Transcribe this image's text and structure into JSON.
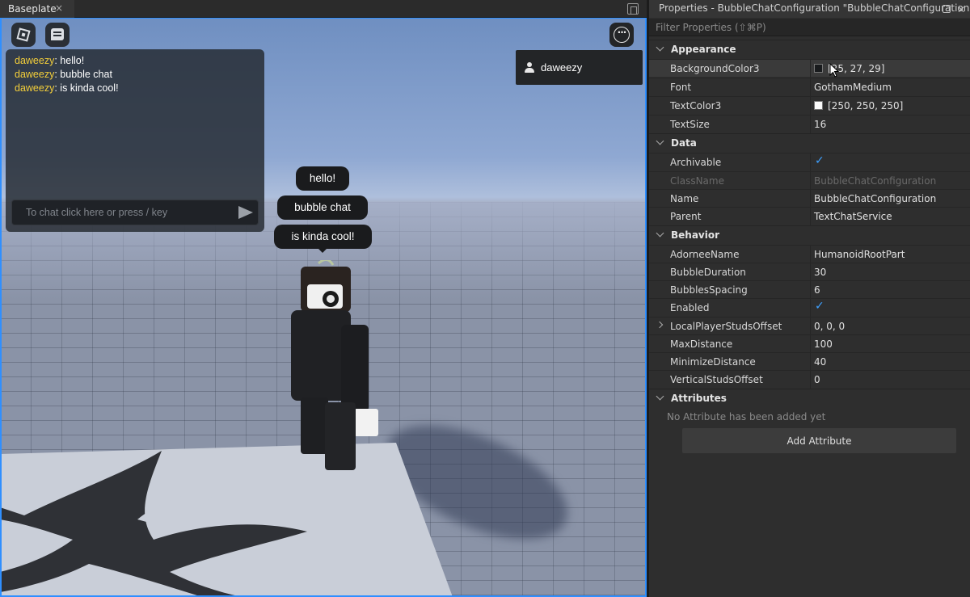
{
  "viewport": {
    "tab_label": "Baseplate",
    "tab_close": "×",
    "chat": {
      "messages": [
        {
          "user": "daweezy",
          "text": ": hello!"
        },
        {
          "user": "daweezy",
          "text": ": bubble chat"
        },
        {
          "user": "daweezy",
          "text": ": is kinda cool!"
        }
      ],
      "input_placeholder": "To chat click here or press / key"
    },
    "player_list": {
      "player": "daweezy"
    },
    "bubbles": [
      "hello!",
      "bubble chat",
      "is kinda cool!"
    ],
    "menu_glyph": "···"
  },
  "properties": {
    "title": "Properties - BubbleChatConfiguration \"BubbleChatConfiguration\"",
    "close_glyph": "✕",
    "filter_placeholder": "Filter Properties (⇧⌘P)",
    "sections": {
      "appearance": "Appearance",
      "data": "Data",
      "behavior": "Behavior",
      "attributes": "Attributes"
    },
    "appearance": {
      "background_color3": {
        "name": "BackgroundColor3",
        "value": "[25, 27, 29]",
        "swatch": "#191b1d"
      },
      "font": {
        "name": "Font",
        "value": "GothamMedium"
      },
      "text_color3": {
        "name": "TextColor3",
        "value": "[250, 250, 250]",
        "swatch": "#fafafa"
      },
      "text_size": {
        "name": "TextSize",
        "value": "16"
      }
    },
    "data": {
      "archivable": {
        "name": "Archivable",
        "value": "✓"
      },
      "class_name": {
        "name": "ClassName",
        "value": "BubbleChatConfiguration"
      },
      "name": {
        "name": "Name",
        "value": "BubbleChatConfiguration"
      },
      "parent": {
        "name": "Parent",
        "value": "TextChatService"
      }
    },
    "behavior": {
      "adornee_name": {
        "name": "AdorneeName",
        "value": "HumanoidRootPart"
      },
      "bubble_duration": {
        "name": "BubbleDuration",
        "value": "30"
      },
      "bubbles_spacing": {
        "name": "BubblesSpacing",
        "value": "6"
      },
      "enabled": {
        "name": "Enabled",
        "value": "✓"
      },
      "local_player_studs_offset": {
        "name": "LocalPlayerStudsOffset",
        "value": "0, 0, 0"
      },
      "max_distance": {
        "name": "MaxDistance",
        "value": "100"
      },
      "minimize_distance": {
        "name": "MinimizeDistance",
        "value": "40"
      },
      "vertical_studs_offset": {
        "name": "VerticalStudsOffset",
        "value": "0"
      }
    },
    "attributes": {
      "empty_text": "No Attribute has been added yet",
      "add_button": "Add Attribute"
    }
  }
}
